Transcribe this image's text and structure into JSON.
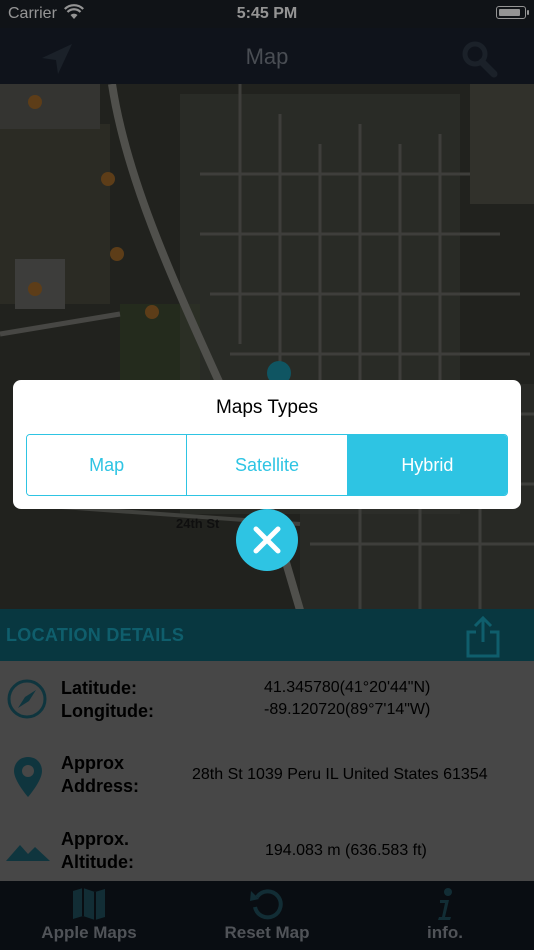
{
  "status_bar": {
    "carrier": "Carrier",
    "time": "5:45 PM",
    "battery_level": 0.9
  },
  "nav_bar": {
    "title": "Map",
    "left_icon": "location-arrow-icon",
    "right_icon": "search-icon"
  },
  "map": {
    "street_label": "24th St"
  },
  "details": {
    "header": "LOCATION DETAILS",
    "share_icon": "share-icon",
    "coords": {
      "latitude_label": "Latitude:",
      "longitude_label": "Longitude:",
      "latitude_value": "41.345780(41°20'44\"N)",
      "longitude_value": "-89.120720(89°7'14\"W)",
      "icon": "compass-icon"
    },
    "address": {
      "label_line1": "Approx",
      "label_line2": "Address:",
      "value": "28th St 1039 Peru  IL United States 61354",
      "icon": "map-pin-icon"
    },
    "altitude": {
      "label_line1": "Approx.",
      "label_line2": "Altitude:",
      "value": "194.083 m (636.583 ft)",
      "icon": "mountain-icon"
    }
  },
  "tab_bar": {
    "tabs": [
      {
        "label": "Apple Maps",
        "icon": "folded-map-icon"
      },
      {
        "label": "Reset Map",
        "icon": "reset-icon"
      },
      {
        "label": "info.",
        "icon": "info-icon"
      }
    ]
  },
  "modal": {
    "title": "Maps Types",
    "options": [
      "Map",
      "Satellite",
      "Hybrid"
    ],
    "selected": "Hybrid",
    "close_icon": "close-icon"
  },
  "colors": {
    "accent": "#2ec4e3",
    "header_teal": "#0f5f6f",
    "nav": "#1a2230"
  }
}
